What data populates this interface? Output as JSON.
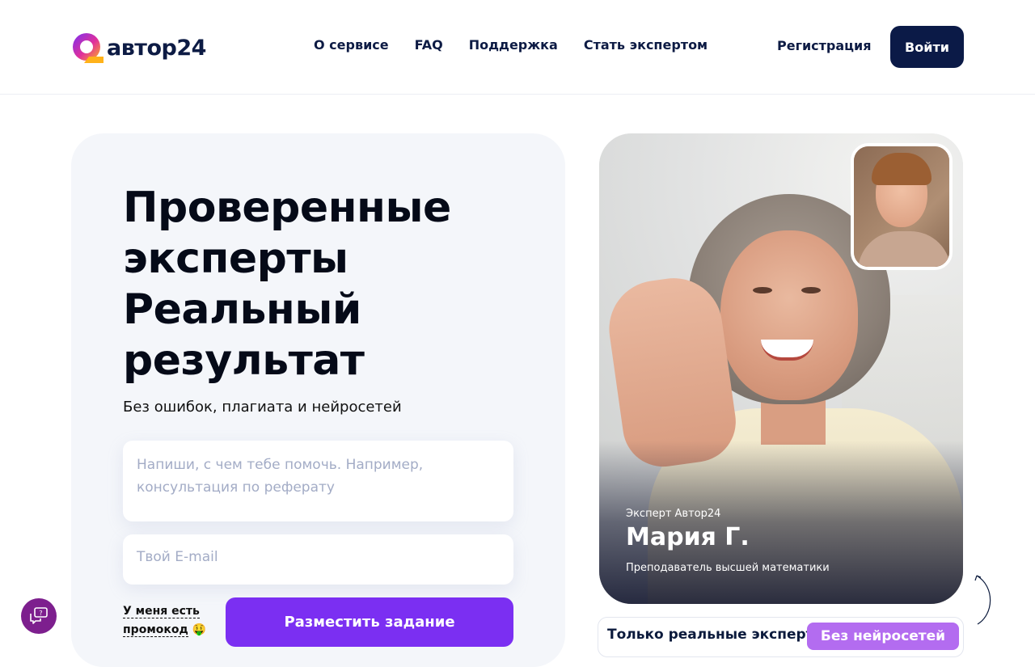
{
  "header": {
    "logo_text": "автор24",
    "nav": [
      "О сервисе",
      "FAQ",
      "Поддержка",
      "Стать экспертом"
    ],
    "register_label": "Регистрация",
    "login_label": "Войти"
  },
  "hero": {
    "headline_lines": [
      "Проверенные",
      "эксперты",
      "Реальный",
      "результат"
    ],
    "subheadline": "Без ошибок, плагиата и нейросетей",
    "task_placeholder": "Напиши, с чем тебе помочь. Например, консультация по реферату",
    "email_placeholder": "Твой E-mail",
    "promo_label": "У меня есть промокод",
    "promo_emoji": "🤑",
    "submit_label": "Разместить задание"
  },
  "expert": {
    "tag": "Эксперт Автор24",
    "name": "Мария Г.",
    "role": "Преподаватель высшей математики"
  },
  "strip": {
    "text": "Только реальные эксперты",
    "badge": "Без нейросетей"
  },
  "colors": {
    "brand_dark": "#0b1a47",
    "accent_purple": "#7b2ff2",
    "badge_purple": "#b36cf0",
    "chat_fab": "#7d1f8e"
  },
  "icons": {
    "logo": "avtor24-logo-icon",
    "chat": "chat-question-icon",
    "scroll": "scroll-arrow-icon"
  }
}
